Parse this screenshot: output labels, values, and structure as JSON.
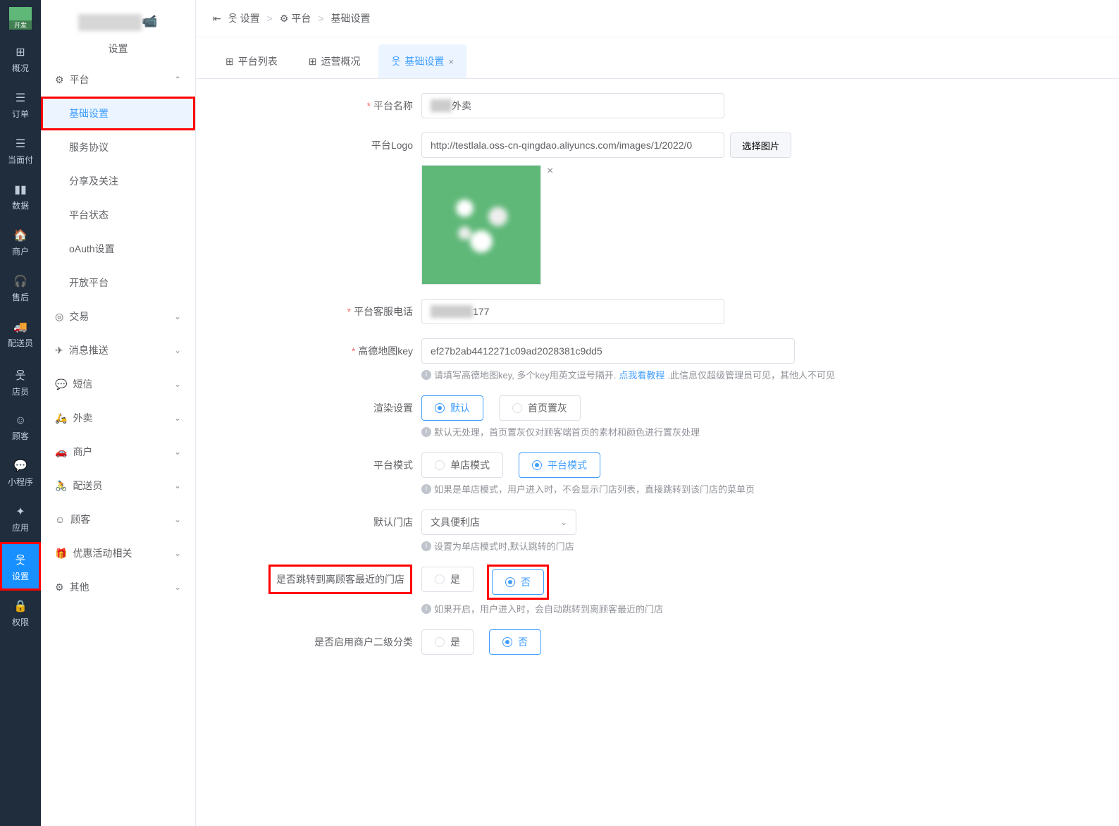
{
  "nav": {
    "items": [
      {
        "icon": "⊞",
        "label": "概况"
      },
      {
        "icon": "☰",
        "label": "订单"
      },
      {
        "icon": "☰",
        "label": "当面付"
      },
      {
        "icon": "▮▮",
        "label": "数据"
      },
      {
        "icon": "🏠",
        "label": "商户"
      },
      {
        "icon": "🎧",
        "label": "售后"
      },
      {
        "icon": "🚚",
        "label": "配送员"
      },
      {
        "icon": "웃",
        "label": "店员"
      },
      {
        "icon": "☺",
        "label": "顾客"
      },
      {
        "icon": "💬",
        "label": "小程序"
      },
      {
        "icon": "✦",
        "label": "应用"
      },
      {
        "icon": "웃",
        "label": "设置"
      },
      {
        "icon": "🔒",
        "label": "权限"
      }
    ]
  },
  "sub": {
    "title": "设置",
    "groups": {
      "platform": {
        "label": "平台",
        "expanded": true
      },
      "platform_items": [
        {
          "label": "基础设置",
          "active": true
        },
        {
          "label": "服务协议"
        },
        {
          "label": "分享及关注"
        },
        {
          "label": "平台状态"
        },
        {
          "label": "oAuth设置"
        },
        {
          "label": "开放平台"
        }
      ],
      "others": [
        {
          "icon": "◎",
          "label": "交易"
        },
        {
          "icon": "✈",
          "label": "消息推送"
        },
        {
          "icon": "💬",
          "label": "短信"
        },
        {
          "icon": "🛵",
          "label": "外卖"
        },
        {
          "icon": "🚗",
          "label": "商户"
        },
        {
          "icon": "🚴",
          "label": "配送员"
        },
        {
          "icon": "☺",
          "label": "顾客"
        },
        {
          "icon": "🎁",
          "label": "优惠活动相关"
        },
        {
          "icon": "⚙",
          "label": "其他"
        }
      ]
    }
  },
  "breadcrumb": {
    "collapse_icon": "⇤",
    "items": [
      "设置",
      "平台",
      "基础设置"
    ]
  },
  "tabs": [
    {
      "icon": "⊞",
      "label": "平台列表"
    },
    {
      "icon": "⊞",
      "label": "运营概况"
    },
    {
      "icon": "웃",
      "label": "基础设置",
      "active": true,
      "closable": true
    }
  ],
  "form": {
    "platform_name": {
      "label": "平台名称",
      "value": "外卖"
    },
    "platform_logo": {
      "label": "平台Logo",
      "value": "http://testlala.oss-cn-qingdao.aliyuncs.com/images/1/2022/0",
      "upload_btn": "选择图片"
    },
    "service_phone": {
      "label": "平台客服电话",
      "value": "177"
    },
    "amap_key": {
      "label": "高德地图key",
      "value": "ef27b2ab4412271c09ad2028381c9dd5",
      "help1": "请填写高德地图key, 多个key用英文逗号隔开.",
      "link": "点我看教程",
      "help2": ".此信息仅超级管理员可见，其他人不可见"
    },
    "render": {
      "label": "渲染设置",
      "opt1": "默认",
      "opt2": "首页置灰",
      "help": "默认无处理，首页置灰仅对顾客端首页的素材和颜色进行置灰处理"
    },
    "mode": {
      "label": "平台模式",
      "opt1": "单店模式",
      "opt2": "平台模式",
      "help": "如果是单店模式，用户进入时，不会显示门店列表，直接跳转到该门店的菜单页"
    },
    "default_store": {
      "label": "默认门店",
      "value": "文具便利店",
      "help": "设置为单店模式时,默认跳转的门店"
    },
    "jump_nearest": {
      "label": "是否跳转到离顾客最近的门店",
      "opt1": "是",
      "opt2": "否",
      "help": "如果开启，用户进入时，会自动跳转到离顾客最近的门店"
    },
    "enable_l2": {
      "label": "是否启用商户二级分类",
      "opt1": "是",
      "opt2": "否"
    }
  }
}
